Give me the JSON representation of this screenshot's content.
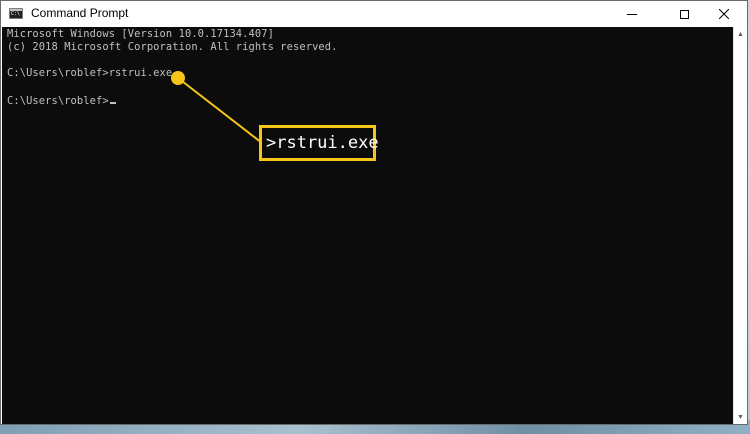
{
  "window": {
    "title": "Command Prompt",
    "controls": {
      "minimize": "minimize",
      "maximize": "maximize",
      "close": "✕"
    }
  },
  "console": {
    "lines": [
      "Microsoft Windows [Version 10.0.17134.407]",
      "(c) 2018 Microsoft Corporation. All rights reserved.",
      "C:\\Users\\roblef>rstrui.exe",
      "C:\\Users\\roblef>"
    ],
    "text_color": "#c0c0c0",
    "background": "#0c0c0c"
  },
  "annotation": {
    "callout_text": ">rstrui.exe",
    "accent_color": "#f5c518"
  },
  "scrollbar": {
    "up_icon": "▲",
    "down_icon": "▼"
  }
}
